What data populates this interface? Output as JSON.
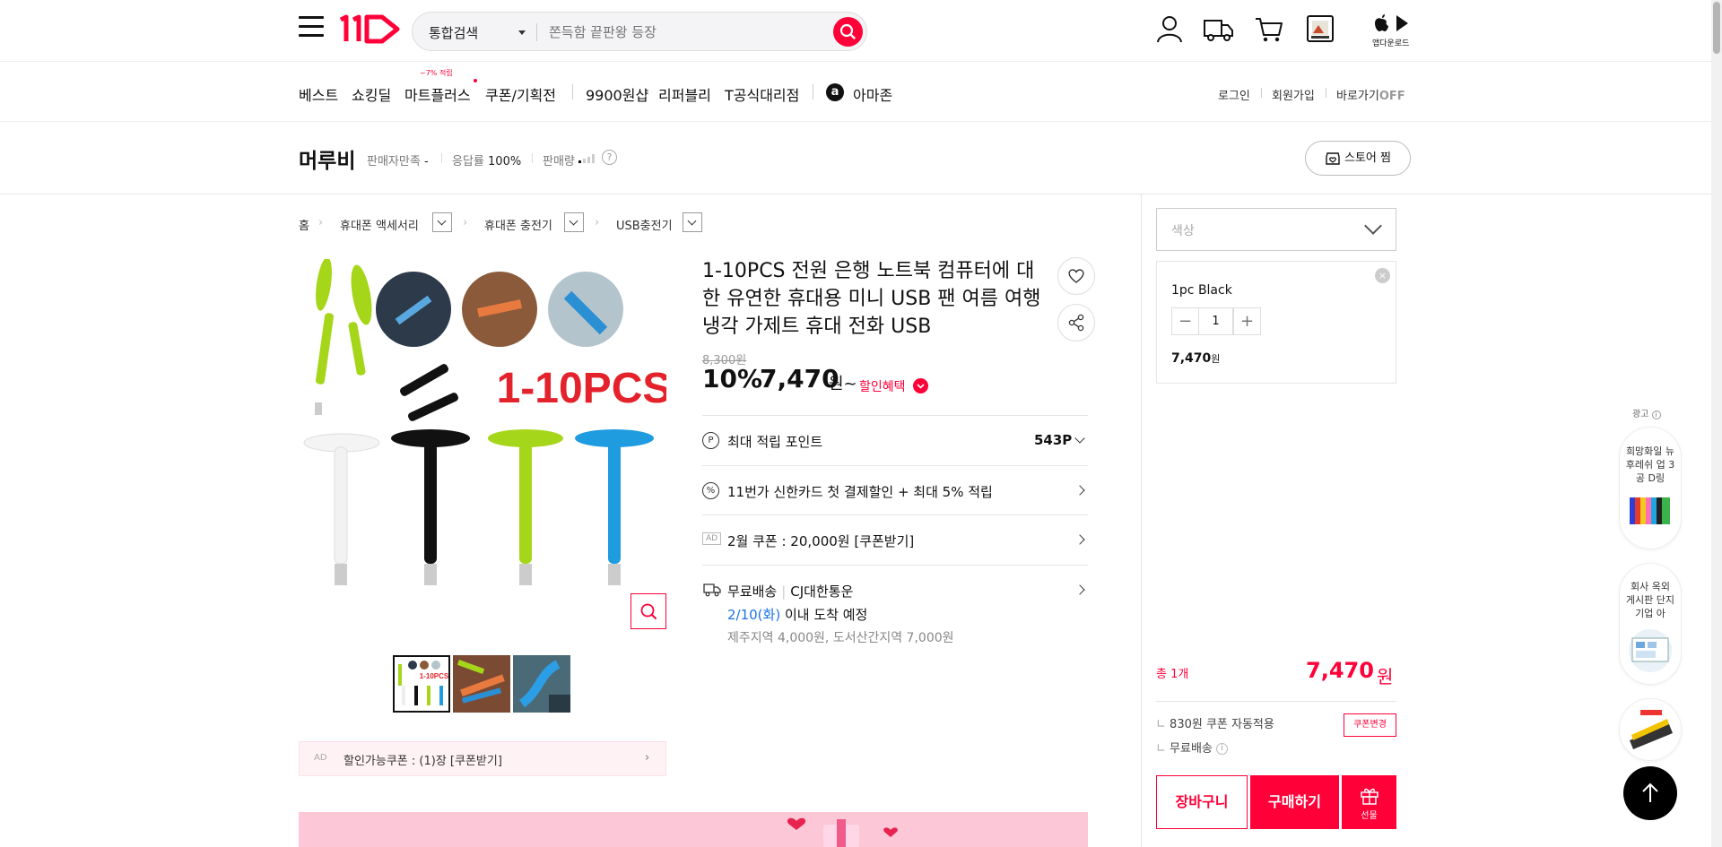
{
  "header": {
    "search_scope": "통합검색",
    "search_placeholder": "쫀득함 끝판왕 등장",
    "app_download": "앱다운로드"
  },
  "nav": {
    "items": [
      "베스트",
      "쇼킹딜",
      "마트플러스",
      "쿠폰/기획전",
      "9900원샵",
      "리퍼블리",
      "T공식대리점",
      "아마존"
    ],
    "mart_badge": "~7% 적립",
    "amazon_logo": "a",
    "right": {
      "login": "로그인",
      "signup": "회원가입",
      "shortcut": "바로가기",
      "shortcut_state": "OFF"
    }
  },
  "seller": {
    "name": "머루비",
    "satisfaction_label": "판매자만족",
    "satisfaction_value": "-",
    "response_label": "응답률",
    "response_value": "100%",
    "sales_label": "판매량",
    "help": "?",
    "store_zzim": "스토어 찜"
  },
  "breadcrumb": [
    "홈",
    "휴대폰 액세서리",
    "휴대폰 충전기",
    "USB충전기"
  ],
  "product": {
    "image_caption": "1-10PCS",
    "title": "1-10PCS 전원 은행 노트북 컴퓨터에 대 한 유연한 휴대용 미니 USB 팬 여름 여행 냉각 가제트 휴대 전화 USB",
    "original_price": "8,300원",
    "discount_rate": "10%",
    "sale_price": "7,470",
    "won_tilde": "원~",
    "benefit_label": "할인혜택"
  },
  "coupon_bar": {
    "ad": "AD",
    "text": "할인가능쿠폰 : (1)장 [쿠폰받기]"
  },
  "benefits": {
    "points_icon": "P",
    "points_label": "최대 적립 포인트",
    "points_value": "543P",
    "card_icon": "%",
    "card_text": "11번가 신한카드 첫 결제할인 + 최대 5% 적립",
    "ad_mark": "AD",
    "coupon_text": "2월 쿠폰 : 20,000원 [쿠폰받기]",
    "shipping_free": "무료배송",
    "shipping_carrier": "CJ대한통운",
    "arrival_date": "2/10(화)",
    "arrival_text": "이내 도착 예정",
    "extra_fee": "제주지역 4,000원, 도서산간지역 7,000원"
  },
  "order": {
    "color_placeholder": "색상",
    "option_name": "1pc Black",
    "option_close": "×",
    "qty_minus": "−",
    "quantity": "1",
    "qty_plus": "+",
    "option_price": "7,470",
    "option_price_unit": "원",
    "total_label": "총 1개",
    "total_price": "7,470",
    "total_unit": "원",
    "coupon_auto": "830원 쿠폰 자동적용",
    "coupon_change": "쿠폰변경",
    "free_shipping": "무료배송",
    "cart": "장바구니",
    "buy": "구매하기",
    "gift": "선물"
  },
  "ads": {
    "label": "광고",
    "card1": "희망화일 뉴 후레쉬 업 3공 D링",
    "card2": "회사 옥외 게시판 단지 기업 아"
  },
  "colors": {
    "brand": "#ff0038",
    "link_blue": "#1a73e8"
  }
}
